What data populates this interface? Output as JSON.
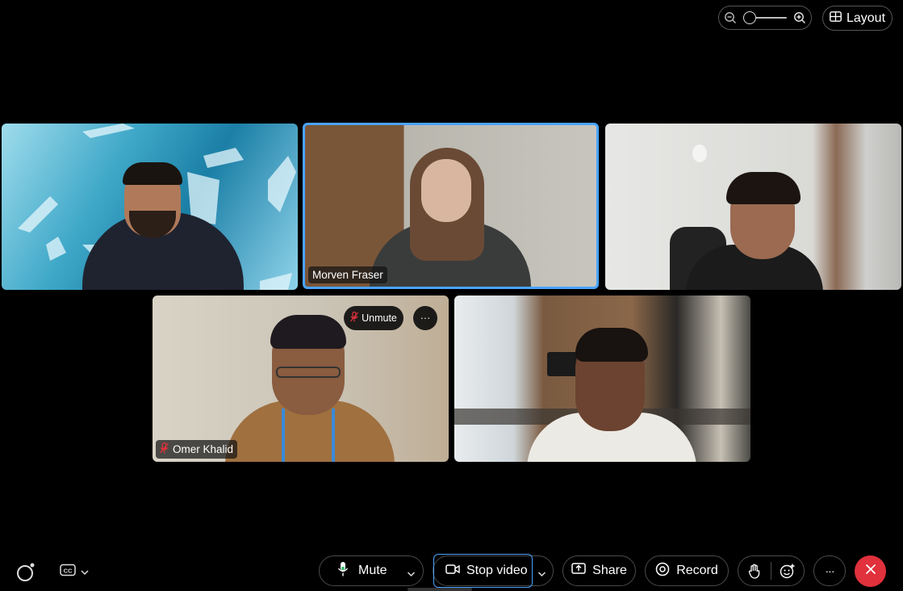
{
  "toolbar_top": {
    "layout_label": "Layout",
    "zoom_icon_out": "zoom-out-icon",
    "zoom_icon_in": "zoom-in-icon",
    "zoom_level": 0
  },
  "participants": [
    {
      "name": "",
      "speaking": false
    },
    {
      "name": "Morven Fraser",
      "speaking": true
    },
    {
      "name": "",
      "speaking": false
    },
    {
      "name": "Omer Khalid",
      "muted": true,
      "speaking": false
    },
    {
      "name": "",
      "speaking": false
    }
  ],
  "tile_actions": {
    "unmute_label": "Unmute",
    "more_label": "···"
  },
  "controls": {
    "mute_label": "Mute",
    "stop_video_label": "Stop video",
    "share_label": "Share",
    "record_label": "Record",
    "more_label": "···",
    "cc_icon": "closed-captions-icon",
    "end_icon": "close-icon"
  },
  "colors": {
    "accent": "#4aa3ff",
    "end_call": "#e0313c",
    "background": "#000000"
  }
}
